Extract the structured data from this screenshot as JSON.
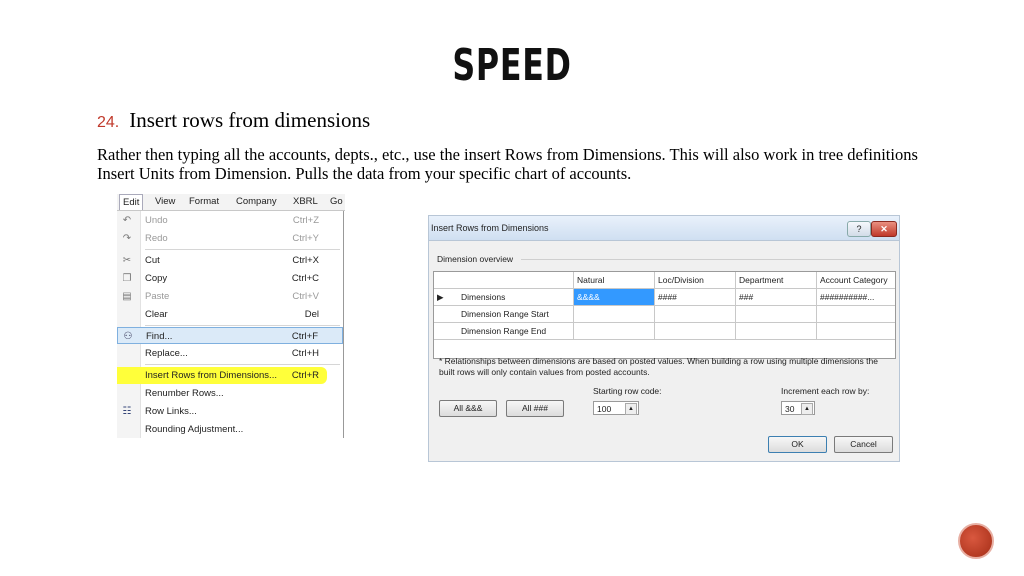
{
  "slide": {
    "title": "SPEED",
    "point_number": "24.",
    "point_text": "Insert rows from dimensions",
    "body": "Rather then typing all the accounts, depts., etc.,  use the insert Rows from Dimensions.  This will also work in tree definitions Insert Units from Dimension.  Pulls the data from your specific chart of accounts."
  },
  "menubar": [
    "Edit",
    "View",
    "Format",
    "Company",
    "XBRL",
    "Go"
  ],
  "menu_items": [
    {
      "icon": "undo-icon",
      "label": "Undo",
      "shortcut": "Ctrl+Z"
    },
    {
      "icon": "redo-icon",
      "label": "Redo",
      "shortcut": "Ctrl+Y"
    },
    {
      "icon": "cut-icon",
      "label": "Cut",
      "shortcut": "Ctrl+X"
    },
    {
      "icon": "copy-icon",
      "label": "Copy",
      "shortcut": "Ctrl+C"
    },
    {
      "icon": "paste-icon",
      "label": "Paste",
      "shortcut": "Ctrl+V"
    },
    {
      "icon": "",
      "label": "Clear",
      "shortcut": "Del"
    },
    {
      "icon": "binoculars-icon",
      "label": "Find...",
      "shortcut": "Ctrl+F"
    },
    {
      "icon": "",
      "label": "Replace...",
      "shortcut": "Ctrl+H"
    },
    {
      "icon": "",
      "label": "Insert Rows from Dimensions...",
      "shortcut": "Ctrl+R"
    },
    {
      "icon": "",
      "label": "Renumber Rows...",
      "shortcut": ""
    },
    {
      "icon": "row-links-icon",
      "label": "Row Links...",
      "shortcut": ""
    },
    {
      "icon": "",
      "label": "Rounding Adjustment...",
      "shortcut": ""
    }
  ],
  "dialog": {
    "title": "Insert Rows from Dimensions",
    "help_label": "?",
    "close_label": "✕",
    "group_label": "Dimension overview",
    "columns": [
      "Natural",
      "Loc/Division",
      "Department",
      "Account Category"
    ],
    "rows": [
      {
        "indicator": "▶",
        "label": "Dimensions",
        "cells": [
          "&&&&",
          "####",
          "###",
          "##########..."
        ]
      },
      {
        "indicator": "",
        "label": "Dimension Range Start",
        "cells": [
          "",
          "",
          "",
          ""
        ]
      },
      {
        "indicator": "",
        "label": "Dimension Range End",
        "cells": [
          "",
          "",
          "",
          ""
        ]
      }
    ],
    "note": "* Relationships between dimensions are based on posted values. When building a row using multiple dimensions the built rows will only contain values from posted accounts.",
    "starting_row_label": "Starting row code:",
    "starting_row_value": "100",
    "increment_label": "Increment each row by:",
    "increment_value": "30",
    "all_amp_label": "All &&&",
    "all_hash_label": "All ###",
    "ok_label": "OK",
    "cancel_label": "Cancel"
  },
  "colors": {
    "highlight": "#ffff00",
    "accent": "#c0392b",
    "selection": "#cfe3f7"
  }
}
